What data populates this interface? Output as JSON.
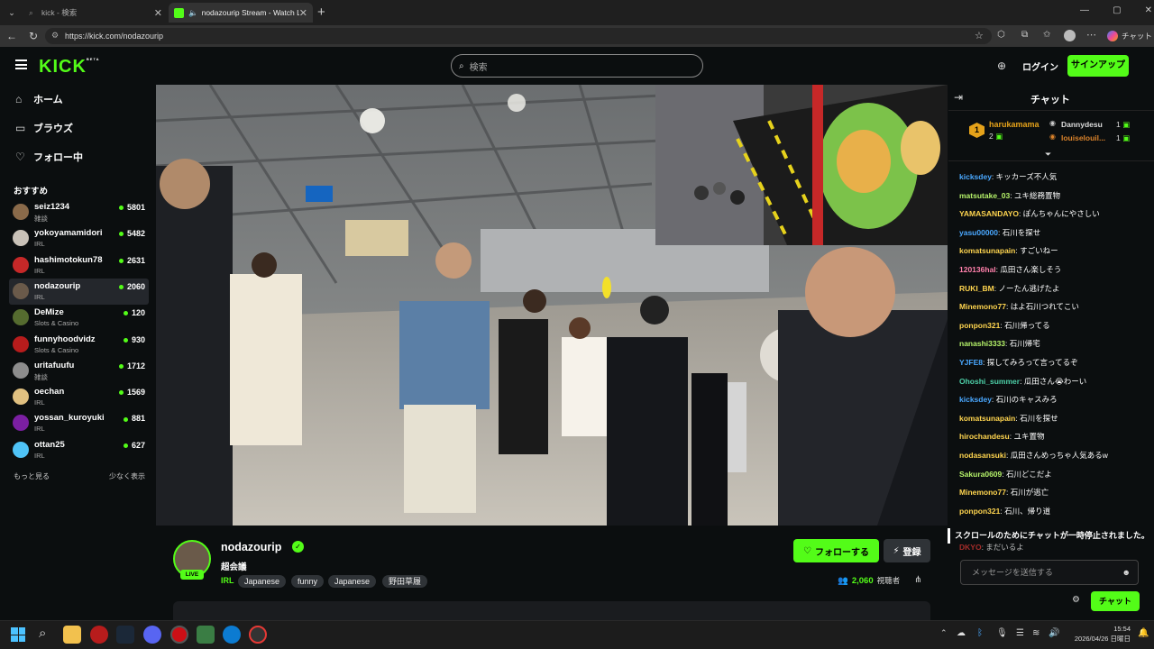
{
  "browser": {
    "tabs": [
      {
        "title": "kick - 検索",
        "active": false
      },
      {
        "title": "nodazourip Stream - Watch Li",
        "active": true
      }
    ],
    "url": "https://kick.com/nodazourip",
    "profile_label": "チャット"
  },
  "header": {
    "logo": "KICK",
    "logo_badge": "BETA",
    "search_placeholder": "検索",
    "login": "ログイン",
    "signup": "サインアップ"
  },
  "sidebar": {
    "nav": [
      {
        "label": "ホーム",
        "icon": "home-icon"
      },
      {
        "label": "ブラウズ",
        "icon": "browse-icon"
      },
      {
        "label": "フォロー中",
        "icon": "heart-icon"
      }
    ],
    "recommended_title": "おすすめ",
    "channels": [
      {
        "name": "seiz1234",
        "category": "雑談",
        "viewers": "5801",
        "color": "#8a6a4a"
      },
      {
        "name": "yokoyamamidori",
        "category": "IRL",
        "viewers": "5482",
        "color": "#c9c2b8"
      },
      {
        "name": "hashimotokun78",
        "category": "IRL",
        "viewers": "2631",
        "color": "#c62828"
      },
      {
        "name": "nodazourip",
        "category": "IRL",
        "viewers": "2060",
        "color": "#6a5a4a",
        "selected": true
      },
      {
        "name": "DeMize",
        "category": "Slots & Casino",
        "viewers": "120",
        "color": "#556b2f"
      },
      {
        "name": "funnyhoodvidz",
        "category": "Slots & Casino",
        "viewers": "930",
        "color": "#b71c1c"
      },
      {
        "name": "uritafuufu",
        "category": "雑談",
        "viewers": "1712",
        "color": "#8d8d8d"
      },
      {
        "name": "oechan",
        "category": "IRL",
        "viewers": "1569",
        "color": "#e0c080"
      },
      {
        "name": "yossan_kuroyuki",
        "category": "IRL",
        "viewers": "881",
        "color": "#7b1fa2"
      },
      {
        "name": "ottan25",
        "category": "IRL",
        "viewers": "627",
        "color": "#4fc3f7"
      }
    ],
    "show_more": "もっと見る",
    "show_less": "少なく表示"
  },
  "stream": {
    "channel": "nodazourip",
    "title": "超会議",
    "live_badge": "LIVE",
    "category": "IRL",
    "tags": [
      "Japanese",
      "funny",
      "Japanese",
      "野田草履"
    ],
    "follow_label": "フォローする",
    "subscribe_label": "登録",
    "viewer_count": "2,060",
    "viewer_suffix": "視聴者"
  },
  "chat": {
    "title": "チャット",
    "leaderboard": [
      {
        "rank": "1",
        "name": "harukamama",
        "count": "2"
      },
      {
        "name": "Dannydesu",
        "count": "1"
      },
      {
        "name": "louiselouil...",
        "count": "1"
      }
    ],
    "messages": [
      {
        "user": "kicksdey",
        "text": "キッカーズ不人気",
        "color": "#4aa8ff"
      },
      {
        "user": "matsutake_03",
        "text": "ユキ総務置物",
        "color": "#b6f36a"
      },
      {
        "user": "YAMASANDAYO",
        "text": "ぽんちゃんにやさしい",
        "color": "#ffd54f"
      },
      {
        "user": "yasu00000",
        "text": "石川を探せ",
        "color": "#4aa8ff"
      },
      {
        "user": "komatsunapain",
        "text": "すごいねー",
        "color": "#ffd54f"
      },
      {
        "user": "120136hal",
        "text": "瓜田さん楽しそう",
        "color": "#ff80ab"
      },
      {
        "user": "RUKI_BM",
        "text": "ノーたん逃げたよ",
        "color": "#ffd54f"
      },
      {
        "user": "Minemono77",
        "text": "はよ石川つれてこい",
        "color": "#ffd54f"
      },
      {
        "user": "ponpon321",
        "text": "石川帰ってる",
        "color": "#ffd54f"
      },
      {
        "user": "nanashi3333",
        "text": "石川帰宅",
        "color": "#b6f36a"
      },
      {
        "user": "YJFE8",
        "text": "探してみろって言ってるぞ",
        "color": "#4aa8ff"
      },
      {
        "user": "Ohoshi_summer",
        "text": "瓜田さん😭わーい",
        "color": "#4dd0a8"
      },
      {
        "user": "kicksdey",
        "text": "石川のキャスみろ",
        "color": "#4aa8ff"
      },
      {
        "user": "komatsunapain",
        "text": "石川を探せ",
        "color": "#ffd54f"
      },
      {
        "user": "hirochandesu",
        "text": "ユキ置物",
        "color": "#ffd54f"
      },
      {
        "user": "nodasansuki",
        "text": "瓜田さんめっちゃ人気あるw",
        "color": "#ffd54f"
      },
      {
        "user": "Sakura0609",
        "text": "石川どこだよ",
        "color": "#b6f36a"
      },
      {
        "user": "Minemono77",
        "text": "石川が逃亡",
        "color": "#ffd54f"
      },
      {
        "user": "ponpon321",
        "text": "石川、帰り道",
        "color": "#ffd54f"
      }
    ],
    "partial_message": {
      "user": "DKYO",
      "text": "まだいるよ",
      "color": "#e53935"
    },
    "paused_notice": "スクロールのためにチャットが一時停止されました。",
    "input_placeholder": "メッセージを送信する",
    "send_label": "チャット"
  },
  "taskbar": {
    "time": "15:54",
    "date": "2026/04/26 日曜日"
  }
}
